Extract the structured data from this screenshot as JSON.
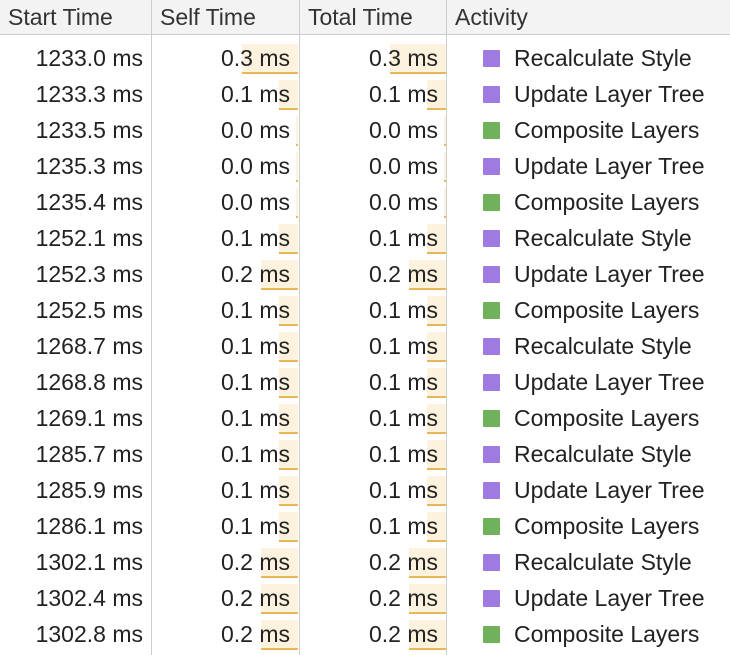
{
  "colors": {
    "rendering": "#9f7ae0",
    "painting": "#70b15c",
    "bar_fill": "#fcf2dd",
    "bar_line": "#e8b75a"
  },
  "columns": {
    "start_time": "Start Time",
    "self_time": "Self Time",
    "total_time": "Total Time",
    "activity": "Activity"
  },
  "rows": [
    {
      "start": "1233.0 ms",
      "self": "0.3 ms",
      "total": "0.3 ms",
      "activity": "Recalculate Style",
      "category": "rendering",
      "self_ms": 0.3,
      "total_ms": 0.3
    },
    {
      "start": "1233.3 ms",
      "self": "0.1 ms",
      "total": "0.1 ms",
      "activity": "Update Layer Tree",
      "category": "rendering",
      "self_ms": 0.1,
      "total_ms": 0.1
    },
    {
      "start": "1233.5 ms",
      "self": "0.0 ms",
      "total": "0.0 ms",
      "activity": "Composite Layers",
      "category": "painting",
      "self_ms": 0.0,
      "total_ms": 0.0
    },
    {
      "start": "1235.3 ms",
      "self": "0.0 ms",
      "total": "0.0 ms",
      "activity": "Update Layer Tree",
      "category": "rendering",
      "self_ms": 0.0,
      "total_ms": 0.0
    },
    {
      "start": "1235.4 ms",
      "self": "0.0 ms",
      "total": "0.0 ms",
      "activity": "Composite Layers",
      "category": "painting",
      "self_ms": 0.0,
      "total_ms": 0.0
    },
    {
      "start": "1252.1 ms",
      "self": "0.1 ms",
      "total": "0.1 ms",
      "activity": "Recalculate Style",
      "category": "rendering",
      "self_ms": 0.1,
      "total_ms": 0.1
    },
    {
      "start": "1252.3 ms",
      "self": "0.2 ms",
      "total": "0.2 ms",
      "activity": "Update Layer Tree",
      "category": "rendering",
      "self_ms": 0.2,
      "total_ms": 0.2
    },
    {
      "start": "1252.5 ms",
      "self": "0.1 ms",
      "total": "0.1 ms",
      "activity": "Composite Layers",
      "category": "painting",
      "self_ms": 0.1,
      "total_ms": 0.1
    },
    {
      "start": "1268.7 ms",
      "self": "0.1 ms",
      "total": "0.1 ms",
      "activity": "Recalculate Style",
      "category": "rendering",
      "self_ms": 0.1,
      "total_ms": 0.1
    },
    {
      "start": "1268.8 ms",
      "self": "0.1 ms",
      "total": "0.1 ms",
      "activity": "Update Layer Tree",
      "category": "rendering",
      "self_ms": 0.1,
      "total_ms": 0.1
    },
    {
      "start": "1269.1 ms",
      "self": "0.1 ms",
      "total": "0.1 ms",
      "activity": "Composite Layers",
      "category": "painting",
      "self_ms": 0.1,
      "total_ms": 0.1
    },
    {
      "start": "1285.7 ms",
      "self": "0.1 ms",
      "total": "0.1 ms",
      "activity": "Recalculate Style",
      "category": "rendering",
      "self_ms": 0.1,
      "total_ms": 0.1
    },
    {
      "start": "1285.9 ms",
      "self": "0.1 ms",
      "total": "0.1 ms",
      "activity": "Update Layer Tree",
      "category": "rendering",
      "self_ms": 0.1,
      "total_ms": 0.1
    },
    {
      "start": "1286.1 ms",
      "self": "0.1 ms",
      "total": "0.1 ms",
      "activity": "Composite Layers",
      "category": "painting",
      "self_ms": 0.1,
      "total_ms": 0.1
    },
    {
      "start": "1302.1 ms",
      "self": "0.2 ms",
      "total": "0.2 ms",
      "activity": "Recalculate Style",
      "category": "rendering",
      "self_ms": 0.2,
      "total_ms": 0.2
    },
    {
      "start": "1302.4 ms",
      "self": "0.2 ms",
      "total": "0.2 ms",
      "activity": "Update Layer Tree",
      "category": "rendering",
      "self_ms": 0.2,
      "total_ms": 0.2
    },
    {
      "start": "1302.8 ms",
      "self": "0.2 ms",
      "total": "0.2 ms",
      "activity": "Composite Layers",
      "category": "painting",
      "self_ms": 0.2,
      "total_ms": 0.2
    }
  ]
}
